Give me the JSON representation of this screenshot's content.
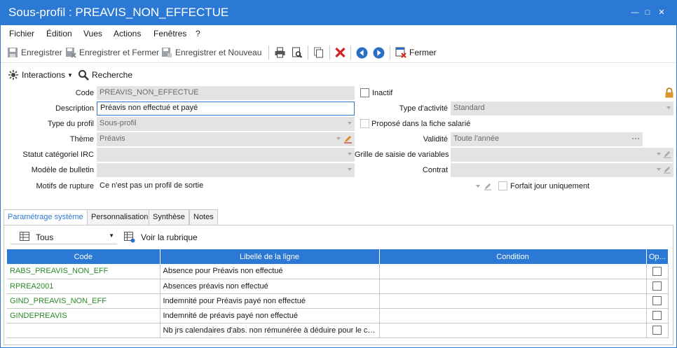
{
  "window": {
    "title": "Sous-profil : PREAVIS_NON_EFFECTUE",
    "minimize": "—",
    "maximize": "□",
    "close": "✕"
  },
  "menu": [
    "Fichier",
    "Édition",
    "Vues",
    "Actions",
    "Fenêtres",
    "?"
  ],
  "toolbar": {
    "save": "Enregistrer",
    "save_close": "Enregistrer et Fermer",
    "save_new": "Enregistrer et Nouveau",
    "close": "Fermer"
  },
  "actions": {
    "interactions": "Interactions",
    "search": "Recherche"
  },
  "form": {
    "code_label": "Code",
    "code_value": "PREAVIS_NON_EFFECTUE",
    "inactive_label": "Inactif",
    "description_label": "Description",
    "description_value": "Préavis non effectué et payé",
    "activity_type_label": "Type d'activité",
    "activity_type_value": "Standard",
    "profile_type_label": "Type du profil",
    "profile_type_value": "Sous-profil",
    "proposed_label": "Proposé dans la fiche salarié",
    "theme_label": "Thème",
    "theme_value": "Préavis",
    "validity_label": "Validité",
    "validity_value": "Toute l'année",
    "irc_label": "Statut catégoriel IRC",
    "grid_input_label": "Grille de saisie de variables",
    "bulletin_label": "Modèle de bulletin",
    "contract_label": "Contrat",
    "rupture_label": "Motifs de rupture",
    "rupture_value": "Ce n'est pas un profil de sortie",
    "forfait_label": "Forfait jour uniquement"
  },
  "tabs": [
    "Paramétrage système",
    "Personnalisation",
    "Synthèse",
    "Notes"
  ],
  "subtoolbar": {
    "filter_value": "Tous",
    "view_rubric": "Voir la rubrique"
  },
  "table": {
    "headers": [
      "Code",
      "Libellé de la ligne",
      "Condition",
      "Op..."
    ],
    "rows": [
      {
        "code": "RABS_PREAVIS_NON_EFF",
        "label": "Absence pour Préavis non effectué",
        "condition": ""
      },
      {
        "code": "RPREA2001",
        "label": "Absences préavis non effectué",
        "condition": ""
      },
      {
        "code": "GIND_PREAVIS_NON_EFF",
        "label": "Indemnité pour Préavis payé non effectué",
        "condition": ""
      },
      {
        "code": "GINDEPREAVIS",
        "label": "Indemnité de préavis payé non effectué",
        "condition": ""
      },
      {
        "code": "",
        "label": "Nb jrs calendaires d'abs. non rémunérée à déduire pour le cal...",
        "condition": ""
      }
    ]
  },
  "colors": {
    "accent": "#2b79d4",
    "code_text": "#2a8a2a",
    "field_bg": "#e3e3e3"
  }
}
